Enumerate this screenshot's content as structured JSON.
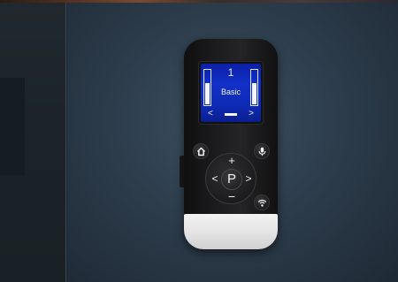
{
  "device": {
    "screen": {
      "program_number": "1",
      "program_name": "Basic",
      "volume_left_level": 0.62,
      "volume_right_level": 0.62,
      "nav_left": "<",
      "nav_right": ">"
    },
    "buttons": {
      "home": "home-icon",
      "mic": "microphone-icon",
      "wifi": "wireless-icon",
      "center_label": "P",
      "up_label": "+",
      "down_label": "−",
      "left_label": "<",
      "right_label": ">"
    },
    "colors": {
      "screen_blue": "#1230c8",
      "body": "#1e1e20",
      "base": "#e6e6e6"
    }
  }
}
